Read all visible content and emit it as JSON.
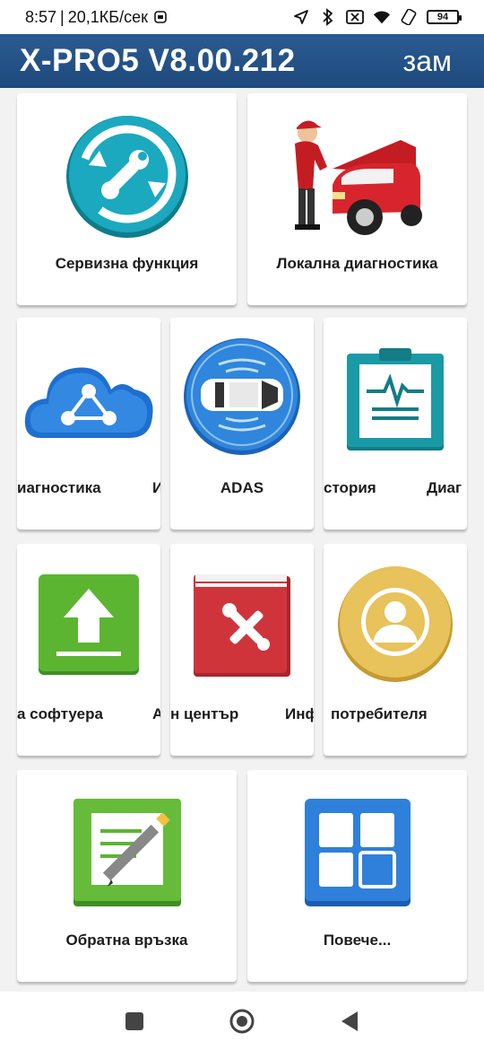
{
  "status_bar": {
    "time": "8:57",
    "speed": "20,1КБ/сек",
    "battery": "94"
  },
  "header": {
    "title": "X-PRO5 V8.00.212",
    "right_text": "зам"
  },
  "tiles": {
    "service": {
      "label": "Сервизна функция",
      "icon": "service-wrench-icon"
    },
    "local_diag": {
      "label": "Локална диагностика",
      "icon": "mechanic-car-icon"
    },
    "remote_diag": {
      "label": "иагностика",
      "label_edge": "И",
      "icon": "cloud-share-icon"
    },
    "adas": {
      "label": "ADAS",
      "icon": "adas-car-icon"
    },
    "history": {
      "label": "стория",
      "label_edge": "Диаг",
      "icon": "clipboard-wave-icon"
    },
    "software": {
      "label": "а софтуера",
      "label_edge": "А",
      "icon": "upload-icon"
    },
    "help": {
      "label": "н център",
      "label_edge": "Инф",
      "icon": "repair-book-icon"
    },
    "user": {
      "label": "потребителя",
      "icon": "user-icon"
    },
    "feedback": {
      "label": "Обратна връзка",
      "icon": "notepad-pencil-icon"
    },
    "more": {
      "label": "Повече...",
      "icon": "grid-icon"
    }
  },
  "colors": {
    "header_bg": "#1f4a7c",
    "teal": "#16a6bd",
    "blue": "#2a7fd6",
    "green": "#5cb531",
    "red": "#d0343b",
    "gold": "#e4c05c"
  }
}
